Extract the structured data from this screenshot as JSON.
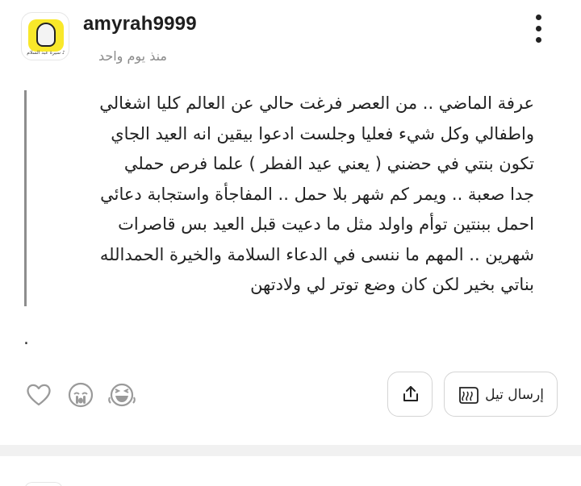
{
  "post": {
    "author": {
      "username": "amyrah9999",
      "avatar_caption": "سيرة عبد السلام ♪"
    },
    "time_ago": "منذ يوم واحد",
    "body_lines": [
      "عرفة الماضي .. من العصر فرغت حالي عن العالم كليا اشغالي",
      "واطفالي وكل شيء فعليا وجلست ادعوا بيقين انه العيد الجاي",
      "تكون بنتي في حضني ( يعني عيد الفطر ) علما فرص حملي",
      "جدا صعبة .. ويمر كم شهر بلا حمل .. المفاجأة واستجابة دعائي",
      "احمل ببنتين توأم واولد مثل ما دعيت قبل العيد بس قاصرات",
      "شهرين .. المهم ما ننسى في الدعاء السلامة والخيرة الحمدالله",
      "بناتي بخير لكن كان وضع توتر لي ولادتهن"
    ],
    "trailing_text": ".",
    "actions": {
      "send_tail_label": "إرسال تيل"
    },
    "icons": {
      "menu": "more-vertical-icon",
      "reactions": [
        "heart-icon",
        "crying-face-icon",
        "laughing-face-icon"
      ],
      "share": "share-icon",
      "tail": "tail-scroll-icon"
    }
  }
}
